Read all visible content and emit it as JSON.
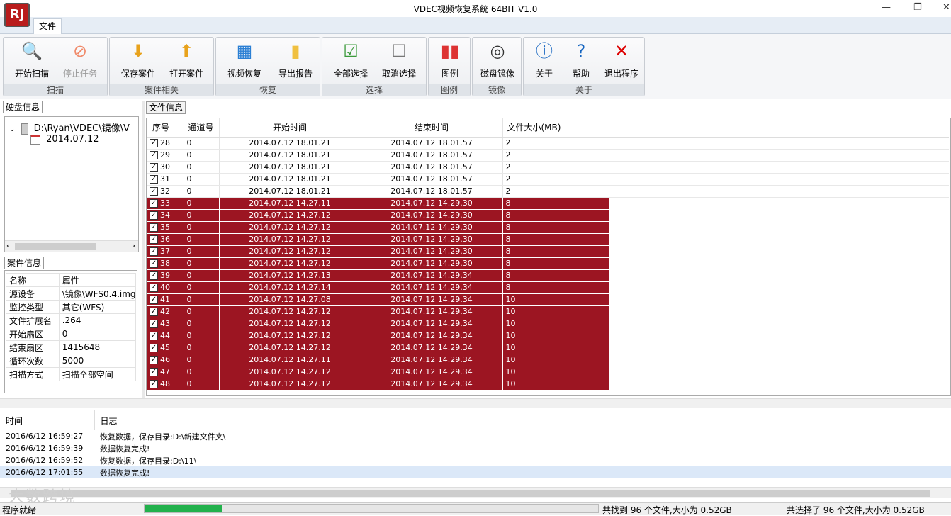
{
  "window": {
    "title": "VDEC视频恢复系统 64BIT V1.0",
    "logo": "Rj"
  },
  "menu": {
    "tab_file": "文件"
  },
  "ribbon": {
    "groups": [
      {
        "label": "扫描",
        "buttons": [
          {
            "label": "开始扫描",
            "icon": "magnifier-icon"
          },
          {
            "label": "停止任务",
            "icon": "stop-icon"
          }
        ]
      },
      {
        "label": "案件相关",
        "buttons": [
          {
            "label": "保存案件",
            "icon": "save-icon"
          },
          {
            "label": "打开案件",
            "icon": "open-icon"
          }
        ]
      },
      {
        "label": "恢复",
        "buttons": [
          {
            "label": "视频恢复",
            "icon": "film-icon"
          },
          {
            "label": "导出报告",
            "icon": "report-icon"
          }
        ]
      },
      {
        "label": "选择",
        "buttons": [
          {
            "label": "全部选择",
            "icon": "select-all-icon"
          },
          {
            "label": "取消选择",
            "icon": "deselect-icon"
          }
        ]
      },
      {
        "label": "图例",
        "buttons": [
          {
            "label": "图例",
            "icon": "bar-chart-icon"
          }
        ]
      },
      {
        "label": "镜像",
        "buttons": [
          {
            "label": "磁盘镜像",
            "icon": "disk-icon"
          }
        ]
      },
      {
        "label": "关于",
        "buttons": [
          {
            "label": "关于",
            "icon": "info-icon"
          },
          {
            "label": "帮助",
            "icon": "help-icon"
          },
          {
            "label": "退出程序",
            "icon": "exit-icon"
          }
        ]
      }
    ]
  },
  "disk_panel": {
    "title": "硬盘信息",
    "root": "D:\\Ryan\\VDEC\\镜像\\V",
    "child": "2014.07.12"
  },
  "case_panel": {
    "title": "案件信息",
    "headers": [
      "名称",
      "属性"
    ],
    "rows": [
      [
        "源设备",
        "\\镜像\\WFS0.4.img"
      ],
      [
        "监控类型",
        "其它(WFS)"
      ],
      [
        "文件扩展名",
        ".264"
      ],
      [
        "开始扇区",
        "0"
      ],
      [
        "结束扇区",
        "1415648"
      ],
      [
        "循环次数",
        "5000"
      ],
      [
        "扫描方式",
        "扫描全部空间"
      ]
    ]
  },
  "file_panel": {
    "title": "文件信息",
    "headers": [
      "序号",
      "通道号",
      "开始时间",
      "结束时间",
      "文件大小(MB)"
    ],
    "rows": [
      {
        "id": "28",
        "ch": "0",
        "start": "2014.07.12 18.01.21",
        "end": "2014.07.12 18.01.57",
        "size": "2",
        "sel": false
      },
      {
        "id": "29",
        "ch": "0",
        "start": "2014.07.12 18.01.21",
        "end": "2014.07.12 18.01.57",
        "size": "2",
        "sel": false
      },
      {
        "id": "30",
        "ch": "0",
        "start": "2014.07.12 18.01.21",
        "end": "2014.07.12 18.01.57",
        "size": "2",
        "sel": false
      },
      {
        "id": "31",
        "ch": "0",
        "start": "2014.07.12 18.01.21",
        "end": "2014.07.12 18.01.57",
        "size": "2",
        "sel": false
      },
      {
        "id": "32",
        "ch": "0",
        "start": "2014.07.12 18.01.21",
        "end": "2014.07.12 18.01.57",
        "size": "2",
        "sel": false
      },
      {
        "id": "33",
        "ch": "0",
        "start": "2014.07.12 14.27.11",
        "end": "2014.07.12 14.29.30",
        "size": "8",
        "sel": true
      },
      {
        "id": "34",
        "ch": "0",
        "start": "2014.07.12 14.27.12",
        "end": "2014.07.12 14.29.30",
        "size": "8",
        "sel": true
      },
      {
        "id": "35",
        "ch": "0",
        "start": "2014.07.12 14.27.12",
        "end": "2014.07.12 14.29.30",
        "size": "8",
        "sel": true
      },
      {
        "id": "36",
        "ch": "0",
        "start": "2014.07.12 14.27.12",
        "end": "2014.07.12 14.29.30",
        "size": "8",
        "sel": true
      },
      {
        "id": "37",
        "ch": "0",
        "start": "2014.07.12 14.27.12",
        "end": "2014.07.12 14.29.30",
        "size": "8",
        "sel": true
      },
      {
        "id": "38",
        "ch": "0",
        "start": "2014.07.12 14.27.12",
        "end": "2014.07.12 14.29.30",
        "size": "8",
        "sel": true
      },
      {
        "id": "39",
        "ch": "0",
        "start": "2014.07.12 14.27.13",
        "end": "2014.07.12 14.29.34",
        "size": "8",
        "sel": true
      },
      {
        "id": "40",
        "ch": "0",
        "start": "2014.07.12 14.27.14",
        "end": "2014.07.12 14.29.34",
        "size": "8",
        "sel": true
      },
      {
        "id": "41",
        "ch": "0",
        "start": "2014.07.12 14.27.08",
        "end": "2014.07.12 14.29.34",
        "size": "10",
        "sel": true
      },
      {
        "id": "42",
        "ch": "0",
        "start": "2014.07.12 14.27.12",
        "end": "2014.07.12 14.29.34",
        "size": "10",
        "sel": true
      },
      {
        "id": "43",
        "ch": "0",
        "start": "2014.07.12 14.27.12",
        "end": "2014.07.12 14.29.34",
        "size": "10",
        "sel": true
      },
      {
        "id": "44",
        "ch": "0",
        "start": "2014.07.12 14.27.12",
        "end": "2014.07.12 14.29.34",
        "size": "10",
        "sel": true
      },
      {
        "id": "45",
        "ch": "0",
        "start": "2014.07.12 14.27.12",
        "end": "2014.07.12 14.29.34",
        "size": "10",
        "sel": true
      },
      {
        "id": "46",
        "ch": "0",
        "start": "2014.07.12 14.27.11",
        "end": "2014.07.12 14.29.34",
        "size": "10",
        "sel": true
      },
      {
        "id": "47",
        "ch": "0",
        "start": "2014.07.12 14.27.12",
        "end": "2014.07.12 14.29.34",
        "size": "10",
        "sel": true
      },
      {
        "id": "48",
        "ch": "0",
        "start": "2014.07.12 14.27.12",
        "end": "2014.07.12 14.29.34",
        "size": "10",
        "sel": true
      }
    ]
  },
  "log": {
    "headers": [
      "时间",
      "日志"
    ],
    "rows": [
      [
        "2016/6/12 16:59:27",
        "恢复数据，保存目录:D:\\新建文件夹\\"
      ],
      [
        "2016/6/12 16:59:39",
        "数据恢复完成!"
      ],
      [
        "2016/6/12 16:59:52",
        "恢复数据，保存目录:D:\\11\\"
      ],
      [
        "2016/6/12 17:01:55",
        "数据恢复完成!"
      ]
    ]
  },
  "status": {
    "ready": "程序就绪",
    "progress": 0.17,
    "found": "共找到 96 个文件,大小为 0.52GB",
    "selected": "共选择了 96 个文件,大小为 0.52GB"
  },
  "watermark": "大数跨境",
  "colors": {
    "selected_row": "#9c1522",
    "progress": "#22b14c",
    "log_highlight": "#dbe8f8"
  }
}
